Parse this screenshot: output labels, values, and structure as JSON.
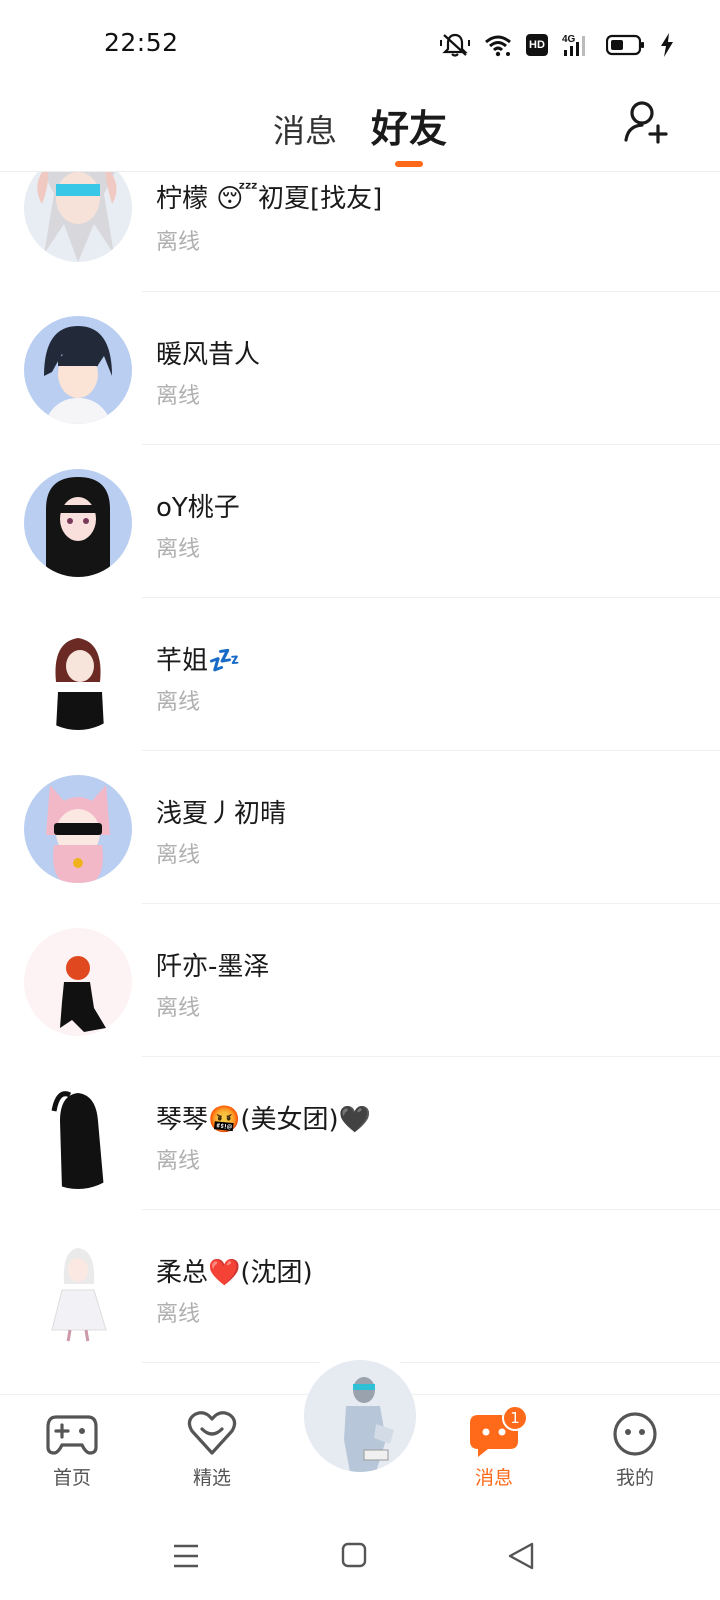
{
  "status_bar": {
    "time": "22:52",
    "icons": [
      "mute-icon",
      "wifi-icon",
      "hd-icon",
      "signal-4g-icon",
      "battery-icon",
      "charging-icon"
    ],
    "hd_label": "HD",
    "network_label": "4G"
  },
  "header": {
    "tabs": [
      {
        "label": "消息",
        "active": false
      },
      {
        "label": "好友",
        "active": true
      }
    ],
    "add_friend_icon": "add-friend-icon",
    "accent_color": "#ff6a1a"
  },
  "friends": [
    {
      "name": "柠檬 😴初夏[找友]",
      "status": "离线"
    },
    {
      "name": "暖风昔人",
      "status": "离线"
    },
    {
      "name": "oY桃子",
      "status": "离线"
    },
    {
      "name": "芊姐💤",
      "status": "离线"
    },
    {
      "name": "浅夏丿初晴",
      "status": "离线"
    },
    {
      "name": "阡亦-墨泽",
      "status": "离线"
    },
    {
      "name": "琴琴🤬(美女团)🖤",
      "status": "离线"
    },
    {
      "name": "柔总❤️(沈团)",
      "status": "离线"
    }
  ],
  "bottom_nav": {
    "items": [
      {
        "label": "首页",
        "icon": "gamepad-icon"
      },
      {
        "label": "精选",
        "icon": "heart-icon"
      },
      {
        "label": "消息",
        "icon": "message-icon",
        "active": true,
        "badge": "1"
      },
      {
        "label": "我的",
        "icon": "face-icon"
      }
    ]
  },
  "system_nav": {
    "icons": [
      "menu-icon",
      "home-icon",
      "back-icon"
    ]
  }
}
